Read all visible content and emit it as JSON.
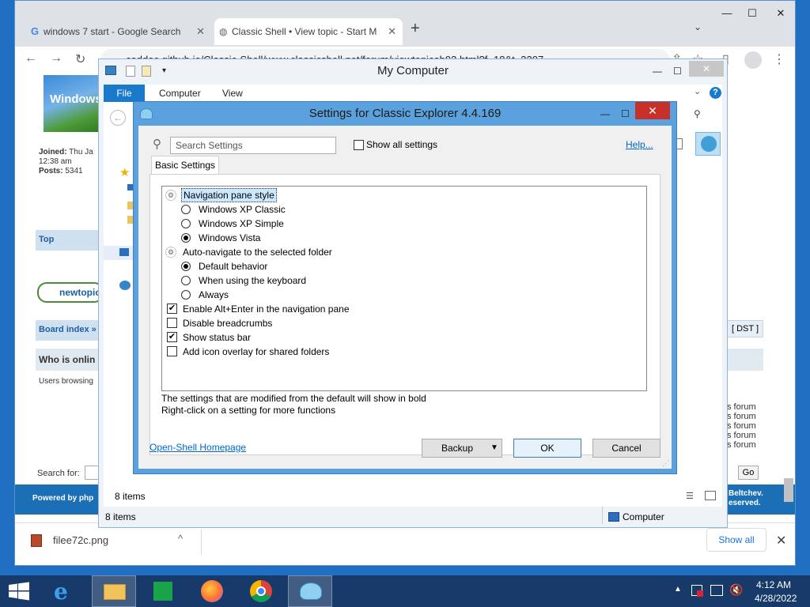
{
  "browser": {
    "tabs": [
      {
        "title": "windows 7 start - Google Search",
        "favicon": "google-g"
      },
      {
        "title": "Classic Shell • View topic - Start M",
        "favicon": "globe"
      }
    ],
    "url": "coddec.github.io/Classic-Shell/www.classicshell.net/forum/viewtopicab93.html?f=18&t=3207"
  },
  "forum": {
    "avatar_text": "Windows",
    "joined_label": "Joined:",
    "joined_value": "Thu Ja",
    "joined_time": "12:38 am",
    "posts_label": "Posts:",
    "posts_value": "5341",
    "top_link": "Top",
    "new_topic": "newtopic",
    "board_index": "Board index »",
    "who_is_online": "Who is onlin",
    "users_browsing": "Users browsing",
    "search_for": "Search for:",
    "powered_by": "Powered by php",
    "dst": "[ DST ]",
    "go": "Go",
    "forum_lines": [
      "s forum",
      "s forum",
      "s forum",
      "s forum",
      "s forum"
    ],
    "footer_right_1": "Beltchev.",
    "footer_right_2": "eserved."
  },
  "download": {
    "filename": "filee72c.png",
    "show_all": "Show all"
  },
  "my_computer": {
    "title": "My Computer",
    "ribbon_tabs": [
      "File",
      "Computer",
      "View"
    ],
    "inner_status": "8 items",
    "status_items": "8 items",
    "status_location": "Computer"
  },
  "dialog": {
    "title": "Settings for Classic Explorer 4.4.169",
    "search_placeholder": "Search Settings",
    "show_all_label": "Show all settings",
    "help_link": "Help...",
    "tab_label": "Basic Settings",
    "settings": [
      {
        "kind": "group",
        "label": "Navigation pane style",
        "selected": true
      },
      {
        "kind": "radio",
        "label": "Windows XP Classic",
        "checked": false
      },
      {
        "kind": "radio",
        "label": "Windows XP Simple",
        "checked": false
      },
      {
        "kind": "radio",
        "label": "Windows Vista",
        "checked": true
      },
      {
        "kind": "group",
        "label": "Auto-navigate to the selected folder",
        "selected": false
      },
      {
        "kind": "radio",
        "label": "Default behavior",
        "checked": true
      },
      {
        "kind": "radio",
        "label": "When using the keyboard",
        "checked": false
      },
      {
        "kind": "radio",
        "label": "Always",
        "checked": false
      },
      {
        "kind": "check",
        "label": "Enable Alt+Enter in the navigation pane",
        "checked": true
      },
      {
        "kind": "check",
        "label": "Disable breadcrumbs",
        "checked": false
      },
      {
        "kind": "check",
        "label": "Show status bar",
        "checked": true
      },
      {
        "kind": "check",
        "label": "Add icon overlay for shared folders",
        "checked": false
      }
    ],
    "info_line1": "The settings that are modified from the default will show in bold",
    "info_line2": "Right-click on a setting for more functions",
    "homepage_link": "Open-Shell Homepage",
    "backup_label": "Backup",
    "ok_label": "OK",
    "cancel_label": "Cancel"
  },
  "taskbar": {
    "items": [
      "start-button",
      "internet-explorer-icon",
      "file-explorer-icon",
      "store-icon",
      "firefox-icon",
      "chrome-icon",
      "classic-shell-icon"
    ],
    "time": "4:12 AM",
    "date": "4/28/2022"
  },
  "colors": {
    "accent": "#1979ca",
    "dialog_border": "#5aa1dd",
    "close_red": "#c7312a",
    "taskbar": "#183a6a"
  }
}
